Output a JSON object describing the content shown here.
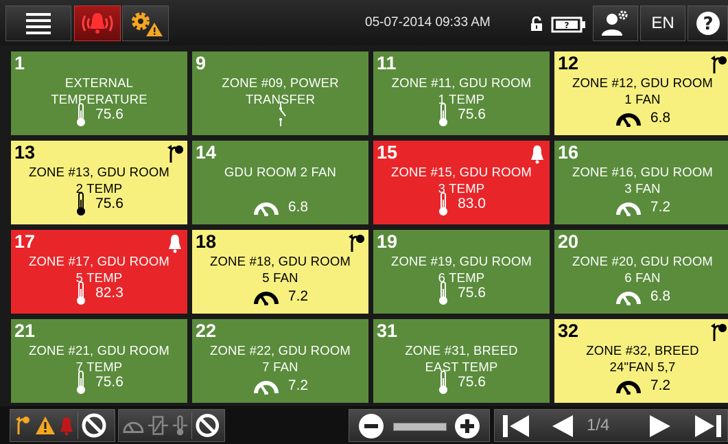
{
  "topbar": {
    "datetime": "05-07-2014 09:33 AM",
    "language": "EN",
    "icons": [
      "menu-icon",
      "alarm-bell-icon",
      "settings-warning-icon",
      "unlock-icon",
      "battery-icon",
      "user-settings-icon",
      "help-icon"
    ]
  },
  "tiles": [
    {
      "num": "1",
      "line1": "EXTERNAL",
      "line2": "TEMPERATURE",
      "value": "75.6",
      "sensor": "thermometer",
      "status": "ok",
      "corner": ""
    },
    {
      "num": "9",
      "line1": "ZONE #09, POWER",
      "line2": "TRANSFER",
      "value": "",
      "sensor": "switch",
      "status": "ok",
      "corner": ""
    },
    {
      "num": "11",
      "line1": "ZONE #11, GDU ROOM",
      "line2": "1 TEMP",
      "value": "75.6",
      "sensor": "thermometer",
      "status": "ok",
      "corner": ""
    },
    {
      "num": "12",
      "line1": "ZONE #12, GDU ROOM",
      "line2": "1 FAN",
      "value": "6.8",
      "sensor": "gauge",
      "status": "warn",
      "corner": "bypass"
    },
    {
      "num": "13",
      "line1": "ZONE #13, GDU ROOM",
      "line2": "2 TEMP",
      "value": "75.6",
      "sensor": "thermometer",
      "status": "warn",
      "corner": "bypass"
    },
    {
      "num": "14",
      "line1": "GDU ROOM 2 FAN",
      "line2": "",
      "value": "6.8",
      "sensor": "gauge",
      "status": "ok",
      "corner": ""
    },
    {
      "num": "15",
      "line1": "ZONE #15, GDU ROOM",
      "line2": "3 TEMP",
      "value": "83.0",
      "sensor": "thermometer",
      "status": "alarm",
      "corner": "bell"
    },
    {
      "num": "16",
      "line1": "ZONE #16, GDU ROOM",
      "line2": "3 FAN",
      "value": "7.2",
      "sensor": "gauge",
      "status": "ok",
      "corner": ""
    },
    {
      "num": "17",
      "line1": "ZONE #17, GDU ROOM",
      "line2": "5 TEMP",
      "value": "82.3",
      "sensor": "thermometer",
      "status": "alarm",
      "corner": "bell"
    },
    {
      "num": "18",
      "line1": "ZONE #18, GDU ROOM",
      "line2": "5 FAN",
      "value": "7.2",
      "sensor": "gauge",
      "status": "warn",
      "corner": "bypass"
    },
    {
      "num": "19",
      "line1": "ZONE #19, GDU ROOM",
      "line2": "6 TEMP",
      "value": "75.6",
      "sensor": "thermometer",
      "status": "ok",
      "corner": ""
    },
    {
      "num": "20",
      "line1": "ZONE #20, GDU ROOM",
      "line2": "6 FAN",
      "value": "6.8",
      "sensor": "gauge",
      "status": "ok",
      "corner": ""
    },
    {
      "num": "21",
      "line1": "ZONE #21, GDU ROOM",
      "line2": "7 TEMP",
      "value": "75.6",
      "sensor": "thermometer",
      "status": "ok",
      "corner": ""
    },
    {
      "num": "22",
      "line1": "ZONE #22, GDU ROOM",
      "line2": "7 FAN",
      "value": "7.2",
      "sensor": "gauge",
      "status": "ok",
      "corner": ""
    },
    {
      "num": "31",
      "line1": "ZONE #31, BREED",
      "line2": "EAST TEMP",
      "value": "75.6",
      "sensor": "thermometer",
      "status": "ok",
      "corner": ""
    },
    {
      "num": "32",
      "line1": "ZONE #32, BREED",
      "line2": "24\"FAN 5,7",
      "value": "7.2",
      "sensor": "gauge",
      "status": "warn",
      "corner": "bypass"
    }
  ],
  "bottombar": {
    "page_indicator": "1/4",
    "icons": [
      "bypass-filter-icon",
      "warning-filter-icon",
      "alarm-filter-icon",
      "block-icon",
      "gauge-filter-icon",
      "switch-filter-icon",
      "thermo-filter-icon",
      "block-icon",
      "zoom-out-icon",
      "zoom-slider",
      "zoom-in-icon",
      "first-page-icon",
      "prev-page-icon",
      "next-page-icon",
      "last-page-icon"
    ]
  },
  "colors": {
    "ok": "#5a8c3c",
    "warn": "#f7f07f",
    "alarm": "#e8262a",
    "accent_orange": "#f5a623"
  }
}
